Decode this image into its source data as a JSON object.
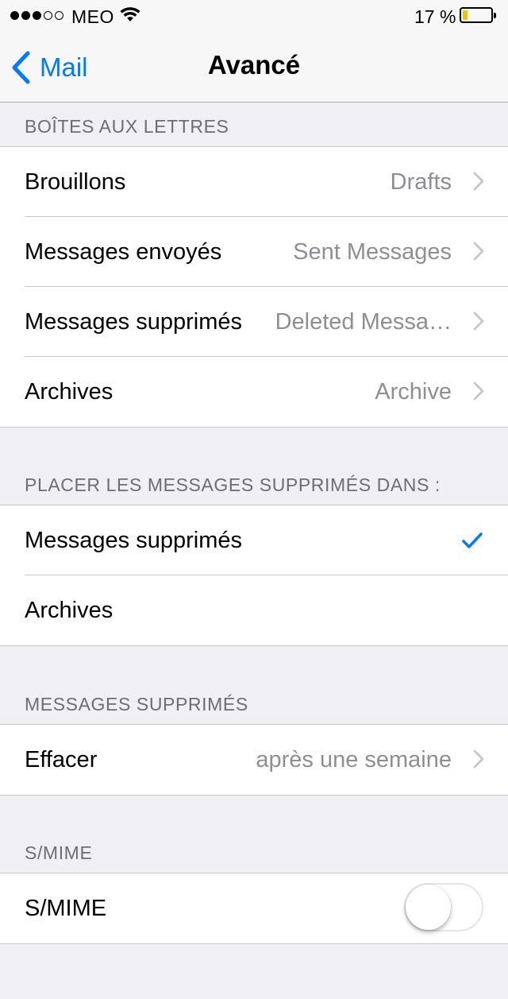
{
  "status_bar": {
    "carrier": "MEO",
    "signal_bars_filled": 3,
    "signal_bars_total": 5,
    "battery_percent": "17 %",
    "battery_level": 0.17,
    "battery_color": "#f2c500"
  },
  "nav": {
    "back_label": "Mail",
    "title": "Avancé",
    "accent": "#007aff"
  },
  "sections": {
    "mailboxes": {
      "header": "BOÎTES AUX LETTRES",
      "rows": [
        {
          "label": "Brouillons",
          "value": "Drafts"
        },
        {
          "label": "Messages envoyés",
          "value": "Sent Messages"
        },
        {
          "label": "Messages supprimés",
          "value": "Deleted Messa…"
        },
        {
          "label": "Archives",
          "value": "Archive"
        }
      ]
    },
    "move_deleted": {
      "header": "PLACER LES MESSAGES SUPPRIMÉS DANS :",
      "rows": [
        {
          "label": "Messages supprimés",
          "selected": true
        },
        {
          "label": "Archives",
          "selected": false
        }
      ]
    },
    "deleted": {
      "header": "MESSAGES SUPPRIMÉS",
      "rows": [
        {
          "label": "Effacer",
          "value": "après une semaine"
        }
      ]
    },
    "smime": {
      "header": "S/MIME",
      "rows": [
        {
          "label": "S/MIME",
          "toggle_on": false
        }
      ]
    }
  },
  "icons": [
    "chevron-left-icon",
    "chevron-right-icon",
    "checkmark-icon",
    "wifi-icon",
    "battery-icon"
  ]
}
